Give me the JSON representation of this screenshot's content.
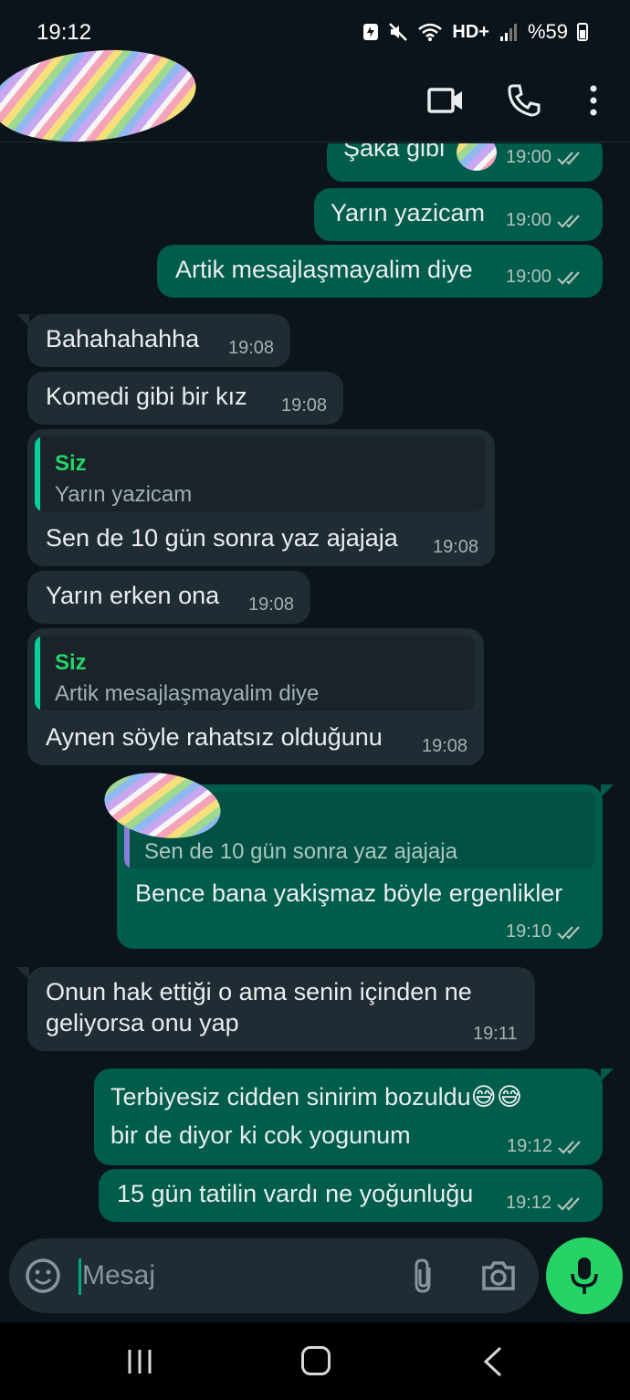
{
  "status_bar": {
    "time": "19:12",
    "battery": "%59",
    "network": "HD+"
  },
  "header": {
    "icons": [
      "back-arrow-icon",
      "video-call-icon",
      "voice-call-icon",
      "more-vert-icon"
    ]
  },
  "messages": [
    {
      "dir": "out",
      "text": "Şaka gibi",
      "time": "19:00",
      "status": "read"
    },
    {
      "dir": "out",
      "text": "Yarın yazicam",
      "time": "19:00",
      "status": "read"
    },
    {
      "dir": "out",
      "text": "Artik mesajlaşmayalim diye",
      "time": "19:00",
      "status": "read"
    },
    {
      "dir": "in",
      "text": "Bahahahahha",
      "time": "19:08"
    },
    {
      "dir": "in",
      "text": "Komedi gibi bir kız",
      "time": "19:08"
    },
    {
      "dir": "in",
      "quote_author": "Siz",
      "quote_text": "Yarın yazicam",
      "text": "Sen de 10 gün sonra yaz ajajaja",
      "time": "19:08"
    },
    {
      "dir": "in",
      "text": "Yarın erken ona",
      "time": "19:08"
    },
    {
      "dir": "in",
      "quote_author": "Siz",
      "quote_text": "Artik mesajlaşmayalim diye",
      "text": "Aynen söyle rahatsız olduğunu",
      "time": "19:08"
    },
    {
      "dir": "out",
      "quote_text": "Sen de 10 gün sonra yaz ajajaja",
      "text": "Bence bana yakişmaz böyle ergenlikler",
      "time": "19:10",
      "status": "read"
    },
    {
      "dir": "in",
      "text_line1": "Onun hak ettiği o ama senin içinden ne",
      "text_line2": "geliyorsa onu yap",
      "time": "19:11"
    },
    {
      "dir": "out",
      "text_line1": "Terbiyesiz cidden sinirim bozuldu😅😅",
      "text_line2": "bir de diyor ki cok yogunum",
      "time": "19:12",
      "status": "read"
    },
    {
      "dir": "out",
      "text": "15 gün tatilin vardı ne yoğunluğu",
      "time": "19:12",
      "status": "read"
    }
  ],
  "input": {
    "placeholder": "Mesaj"
  },
  "colors": {
    "background": "#0b141a",
    "incoming": "#202c33",
    "outgoing": "#005c4b",
    "accent": "#25d366"
  }
}
